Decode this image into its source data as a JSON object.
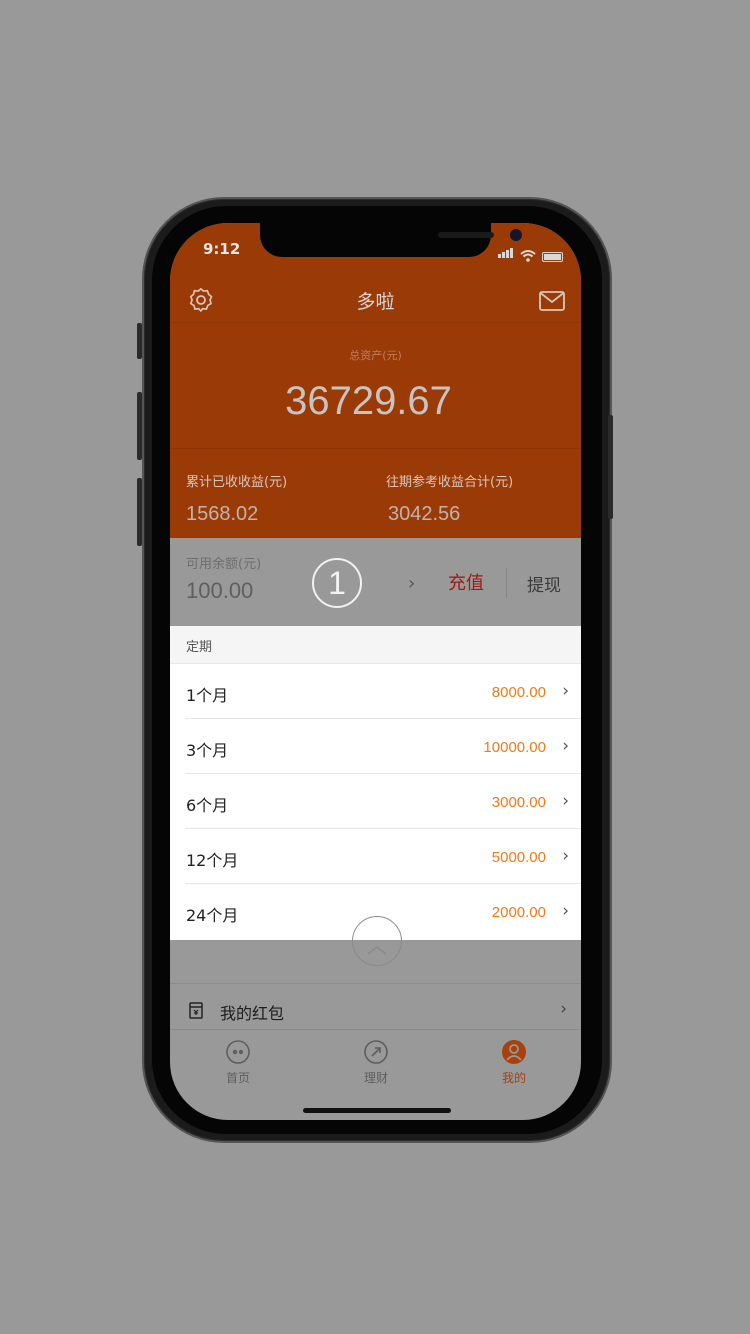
{
  "status_bar": {
    "time": "9:12"
  },
  "header": {
    "title": "多啦",
    "total_assets_label": "总资产(元)",
    "total_assets_value": "36729.67",
    "stats": [
      {
        "label": "累计已收收益(元)",
        "value": "1568.02"
      },
      {
        "label": "往期参考收益合计(元)",
        "value": "3042.56"
      }
    ]
  },
  "balance": {
    "label": "可用余额(元)",
    "value": "100.00",
    "step_badge": "1",
    "recharge_label": "充值",
    "withdraw_label": "提现"
  },
  "fixed_term": {
    "title": "定期",
    "items": [
      {
        "name": "1个月",
        "amount": "8000.00"
      },
      {
        "name": "3个月",
        "amount": "10000.00"
      },
      {
        "name": "6个月",
        "amount": "3000.00"
      },
      {
        "name": "12个月",
        "amount": "5000.00"
      },
      {
        "name": "24个月",
        "amount": "2000.00"
      }
    ]
  },
  "red_packet": {
    "label": "我的红包"
  },
  "tabbar": {
    "items": [
      {
        "label": "首页",
        "icon": "home-icon"
      },
      {
        "label": "理财",
        "icon": "finance-icon"
      },
      {
        "label": "我的",
        "icon": "user-icon",
        "active": true
      }
    ]
  },
  "colors": {
    "brand_orange": "#9a3b07",
    "amount_orange": "#f07a1a",
    "recharge_red": "#9d1c12",
    "overlay_gray": "#999999"
  }
}
